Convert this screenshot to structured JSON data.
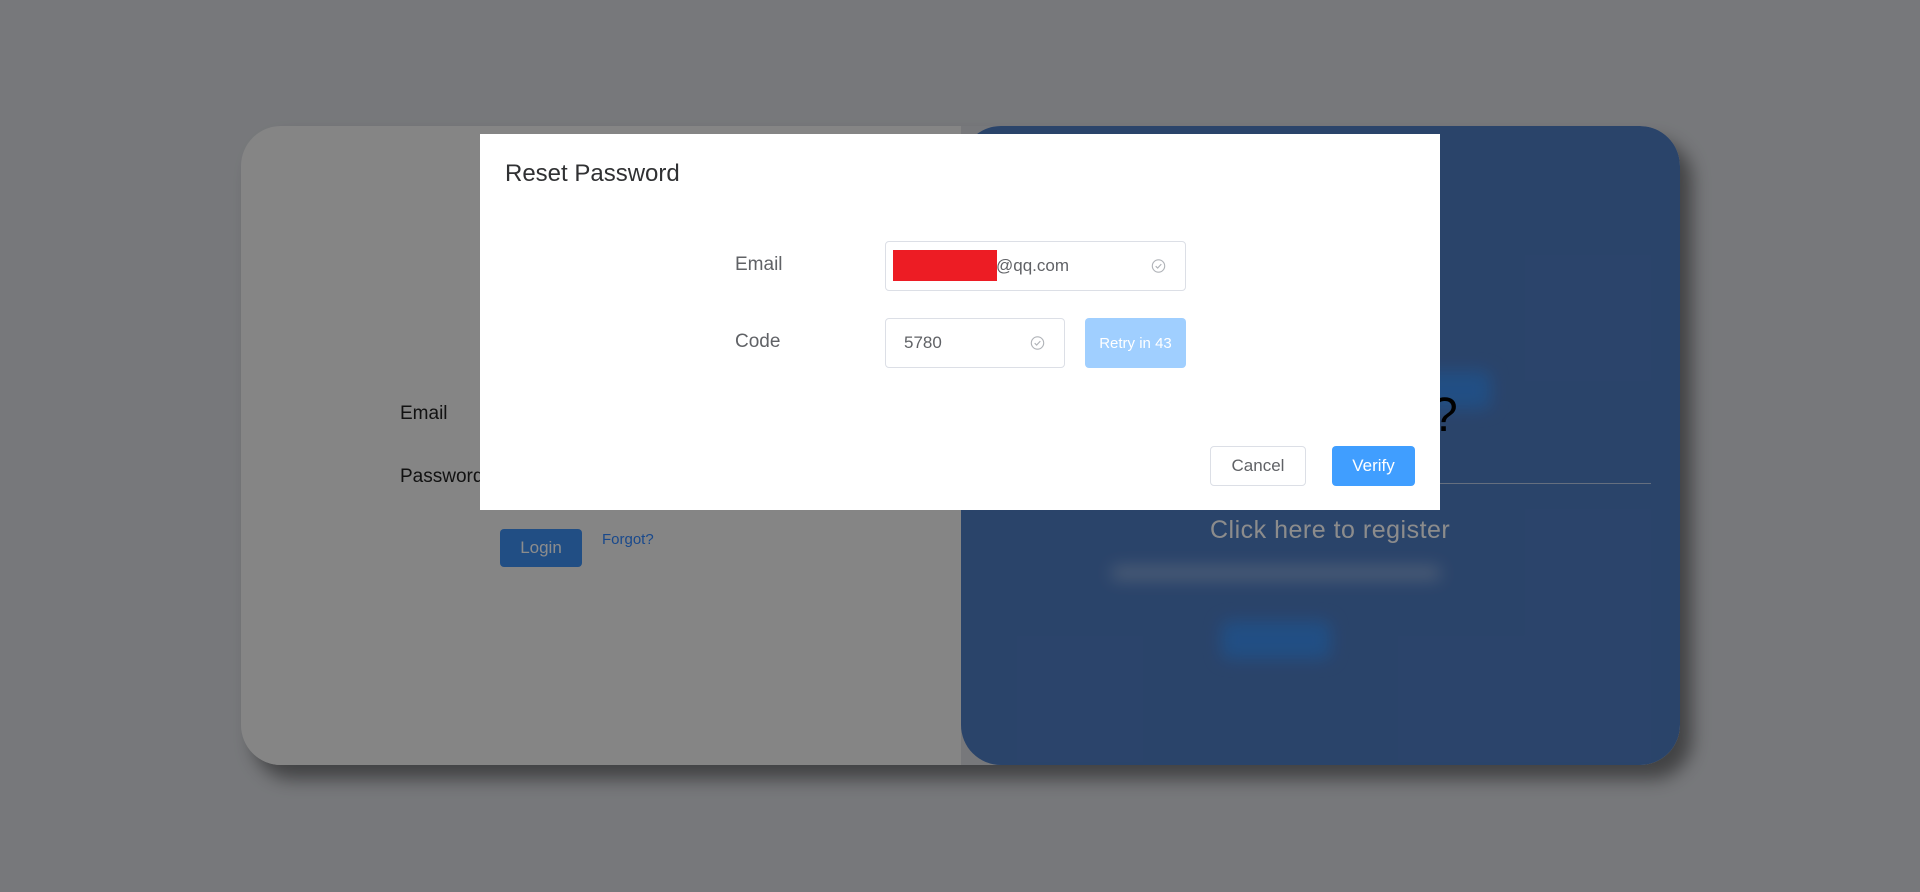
{
  "background": {
    "left_panel": {
      "email_label": "Email",
      "password_label": "Password",
      "login_button": "Login",
      "forgot_link": "Forgot?"
    },
    "right_panel": {
      "question_mark": "?",
      "register_text": "Click here to register"
    }
  },
  "dialog": {
    "title": "Reset Password",
    "email": {
      "label": "Email",
      "value_suffix": "@qq.com"
    },
    "code": {
      "label": "Code",
      "value": "5780"
    },
    "retry_button": "Retry in 43",
    "cancel_button": "Cancel",
    "verify_button": "Verify"
  },
  "colors": {
    "primary": "#409eff",
    "primary_disabled": "#a0cfff",
    "redaction": "#ed1c24"
  },
  "icons": {
    "email_status": "circle-check-icon",
    "code_status": "circle-check-icon"
  }
}
